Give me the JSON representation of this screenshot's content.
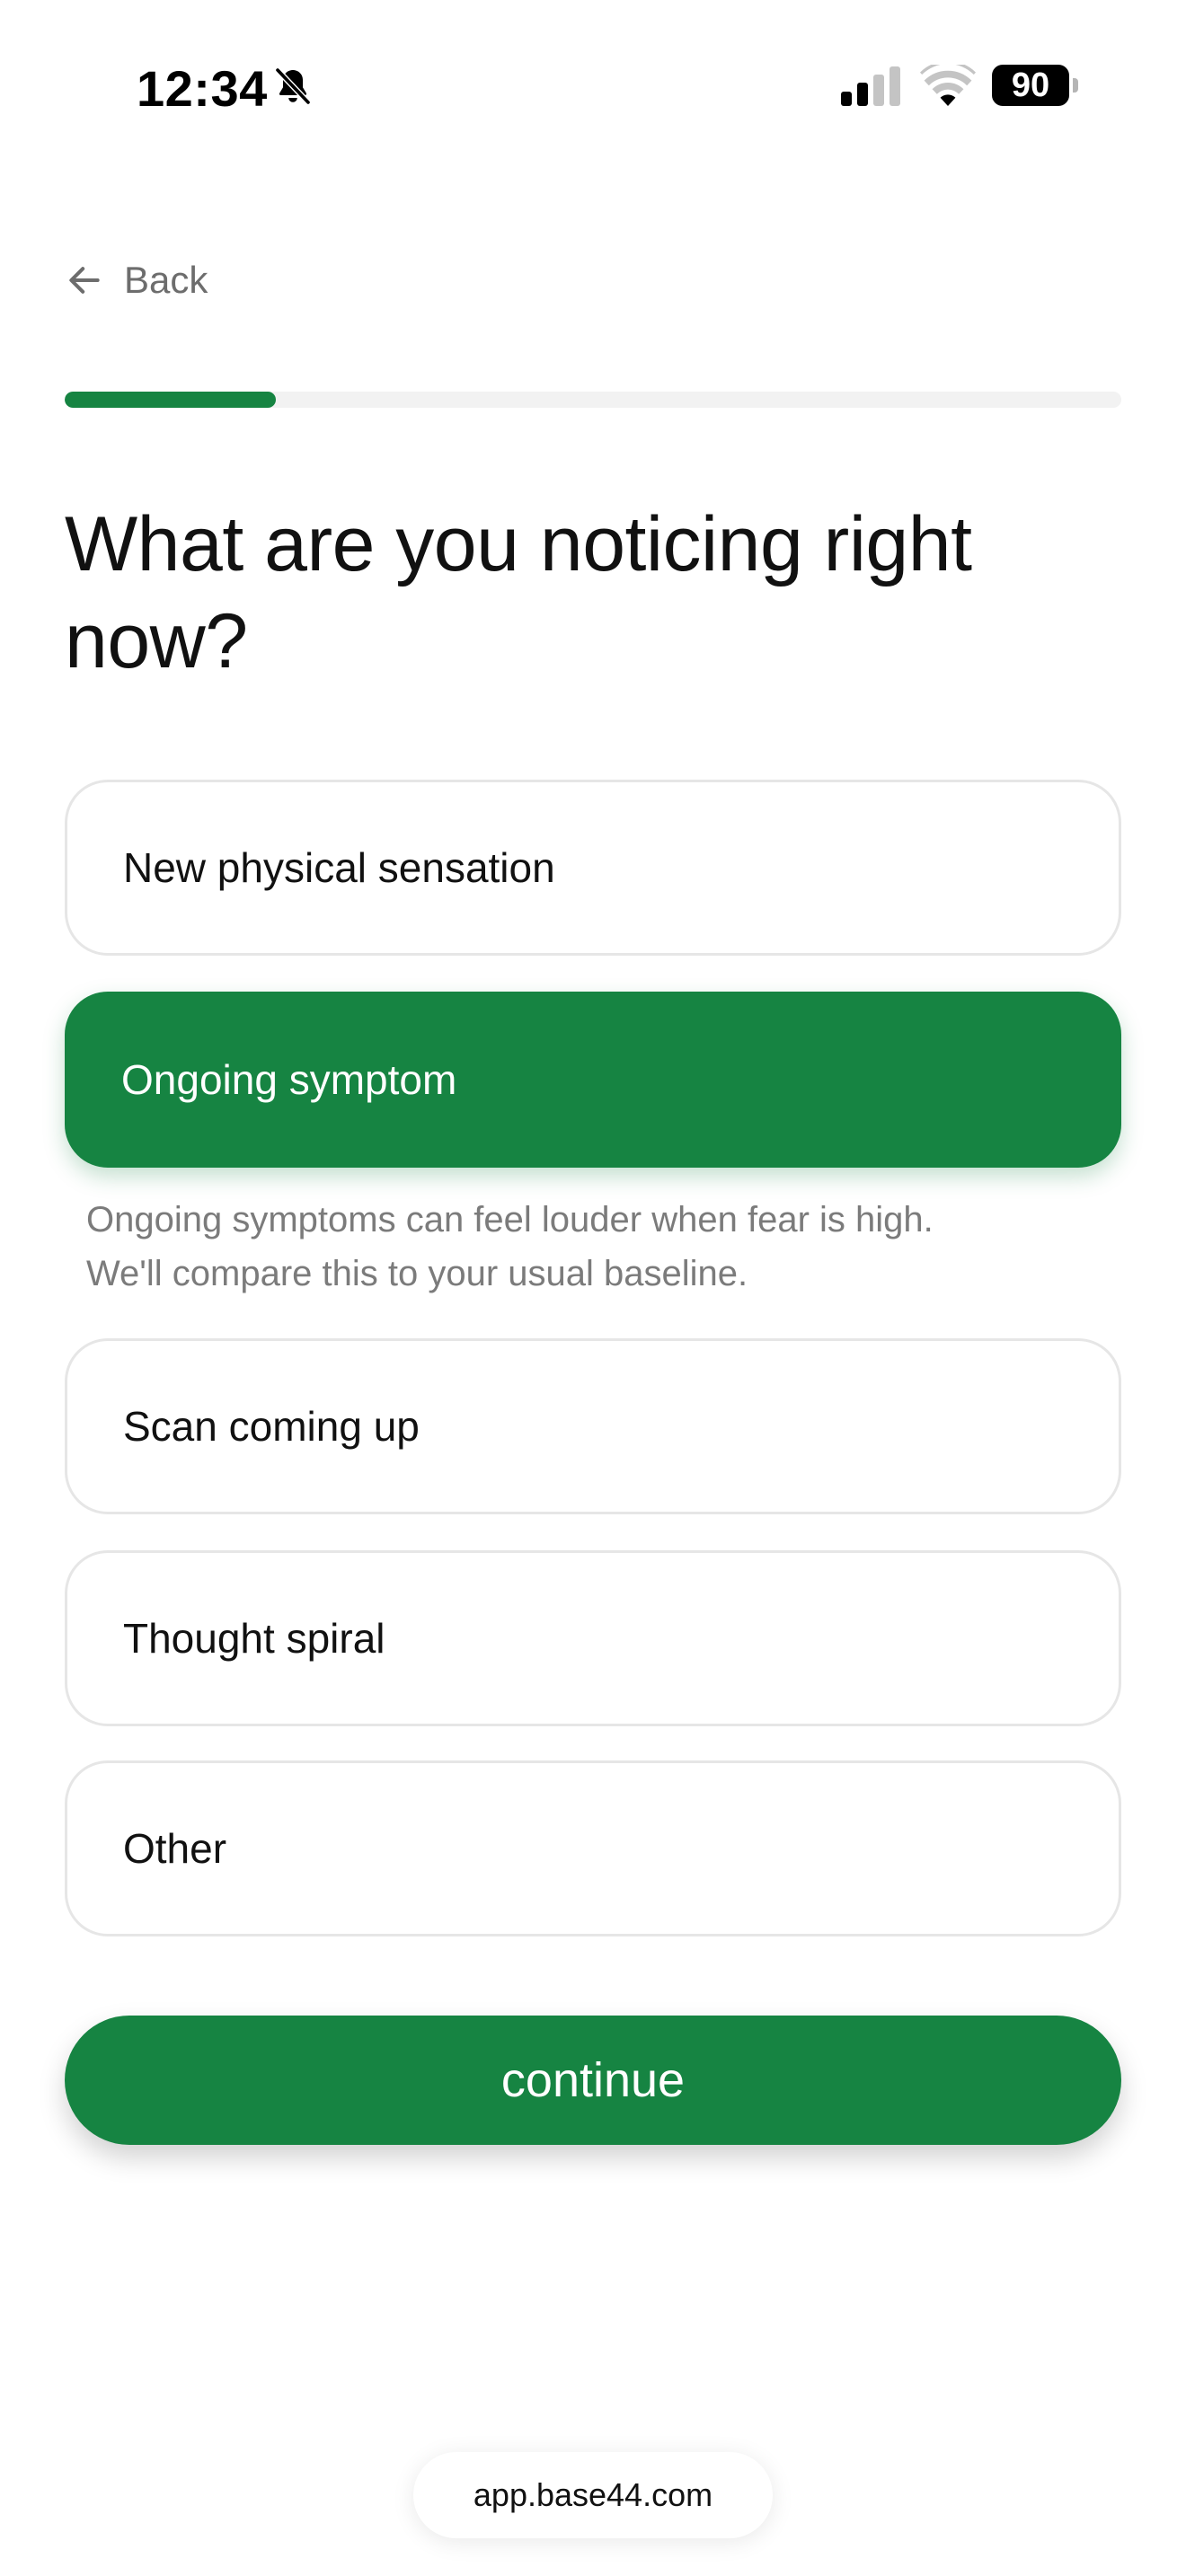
{
  "status_bar": {
    "time": "12:34",
    "battery": "90",
    "icons": [
      "bell-slash-icon",
      "cellular-signal-icon",
      "wifi-icon",
      "battery-icon"
    ]
  },
  "nav": {
    "back_label": "Back",
    "back_icon": "arrow-left-icon"
  },
  "progress": {
    "fraction": 0.2
  },
  "question": {
    "title": "What are you noticing right now?"
  },
  "options": [
    {
      "label": "New physical sensation",
      "selected": false
    },
    {
      "label": "Ongoing symptom",
      "selected": true
    },
    {
      "label": "Scan coming up",
      "selected": false
    },
    {
      "label": "Thought spiral",
      "selected": false
    },
    {
      "label": "Other",
      "selected": false
    }
  ],
  "selected_hint": {
    "line1": "Ongoing symptoms can feel louder when fear is high.",
    "line2": "We'll compare this to your usual baseline."
  },
  "continue_label": "continue",
  "url": "app.base44.com",
  "colors": {
    "accent": "#168442",
    "muted_text": "#7b7b7b",
    "border": "#e6e6e6"
  }
}
